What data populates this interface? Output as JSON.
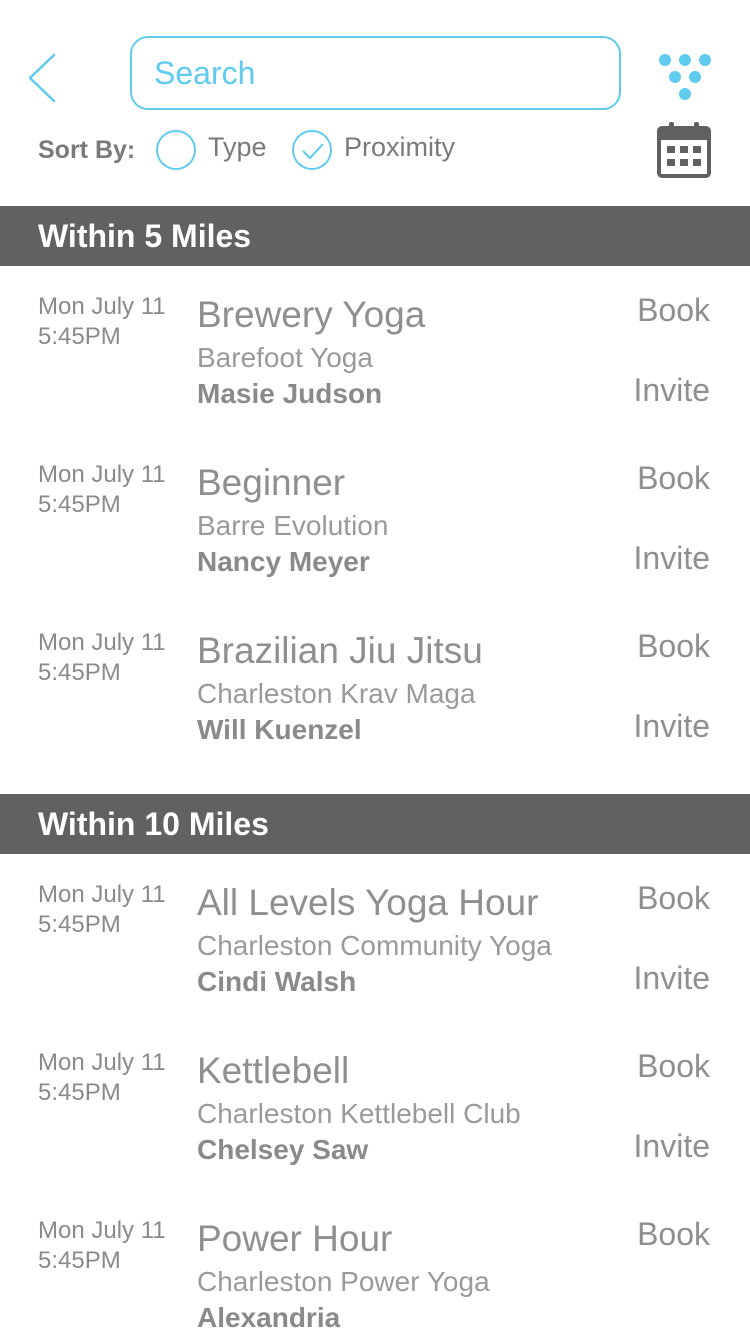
{
  "search": {
    "placeholder": "Search"
  },
  "sort": {
    "label": "Sort By:",
    "options": [
      {
        "label": "Type",
        "checked": false
      },
      {
        "label": "Proximity",
        "checked": true
      }
    ]
  },
  "colors": {
    "accent": "#5fcbef",
    "header_bg": "#616161",
    "text": "#8a8a8a"
  },
  "sections": [
    {
      "title": "Within 5 Miles",
      "items": [
        {
          "day": "Mon July 11",
          "time": "5:45PM",
          "title": "Brewery Yoga",
          "studio": "Barefoot Yoga",
          "instructor": "Masie Judson",
          "book": "Book",
          "invite": "Invite"
        },
        {
          "day": "Mon July 11",
          "time": "5:45PM",
          "title": "Beginner",
          "studio": "Barre Evolution",
          "instructor": "Nancy Meyer",
          "book": "Book",
          "invite": "Invite"
        },
        {
          "day": "Mon July 11",
          "time": "5:45PM",
          "title": "Brazilian Jiu Jitsu",
          "studio": "Charleston Krav Maga",
          "instructor": "Will Kuenzel",
          "book": "Book",
          "invite": "Invite"
        }
      ]
    },
    {
      "title": "Within 10 Miles",
      "items": [
        {
          "day": "Mon July 11",
          "time": "5:45PM",
          "title": "All Levels Yoga Hour",
          "studio": "Charleston Community Yoga",
          "instructor": "Cindi Walsh",
          "book": "Book",
          "invite": "Invite"
        },
        {
          "day": "Mon July 11",
          "time": "5:45PM",
          "title": "Kettlebell",
          "studio": "Charleston Kettlebell Club",
          "instructor": "Chelsey Saw",
          "book": "Book",
          "invite": "Invite"
        },
        {
          "day": "Mon July 11",
          "time": "5:45PM",
          "title": "Power Hour",
          "studio": "Charleston Power Yoga",
          "instructor": "Alexandria",
          "book": "Book"
        }
      ]
    }
  ]
}
